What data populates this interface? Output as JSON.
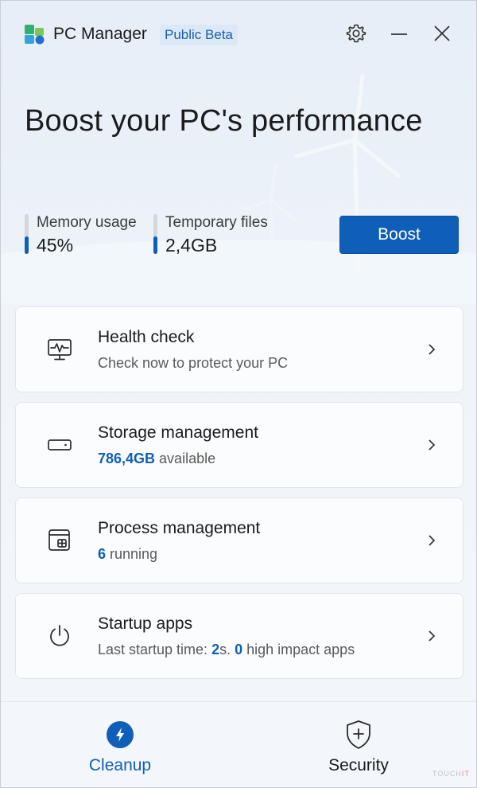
{
  "app": {
    "title": "PC Manager",
    "badge": "Public Beta"
  },
  "titlebar": {
    "settings_icon": "gear-icon",
    "minimize_icon": "minimize-icon",
    "close_icon": "close-icon"
  },
  "hero": {
    "title": "Boost your PC's performance"
  },
  "stats": {
    "memory": {
      "label": "Memory usage",
      "value": "45%",
      "level": 0.45
    },
    "temp": {
      "label": "Temporary files",
      "value": "2,4GB",
      "level": 0.45
    }
  },
  "boost_label": "Boost",
  "cards": [
    {
      "icon": "health-monitor-icon",
      "title": "Health check",
      "sub": "Check now to protect your PC"
    },
    {
      "icon": "storage-drive-icon",
      "title": "Storage management",
      "sub_highlight": "786,4GB",
      "sub_rest": " available"
    },
    {
      "icon": "process-window-icon",
      "title": "Process management",
      "sub_highlight": "6",
      "sub_rest": " running"
    },
    {
      "icon": "power-icon",
      "title": "Startup apps",
      "sub_prefix": "Last startup time: ",
      "sub_h1": "2",
      "sub_mid": "s. ",
      "sub_h2": "0",
      "sub_rest": " high impact apps"
    }
  ],
  "nav": {
    "cleanup": {
      "label": "Cleanup",
      "icon": "lightning-icon"
    },
    "security": {
      "label": "Security",
      "icon": "shield-plus-icon"
    }
  },
  "watermark": {
    "prefix": "TOUCH",
    "suffix": "IT"
  },
  "colors": {
    "accent": "#0f5fb8",
    "badge_bg": "#dbe8f6"
  }
}
